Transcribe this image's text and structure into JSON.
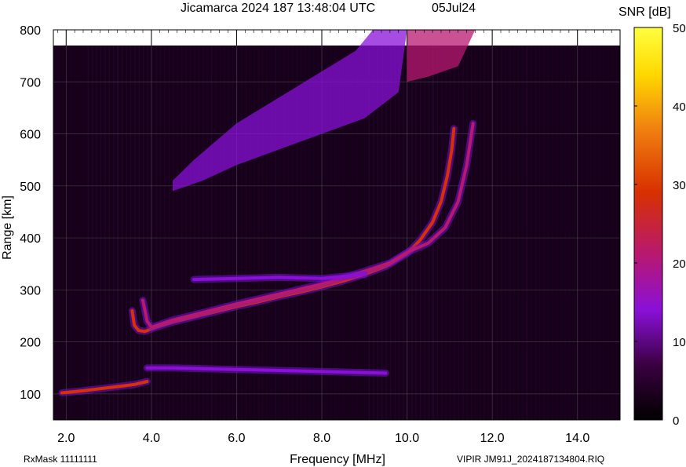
{
  "header": {
    "title": "Jicamarca 2024 187 13:48:04 UTC",
    "date": "05Jul24"
  },
  "footer": {
    "left": "RxMask 11111111",
    "right": "VIPIR  JM91J_2024187134804.RIQ"
  },
  "colorbar": {
    "label": "SNR [dB]",
    "ticks": [
      "50",
      "40",
      "30",
      "20",
      "10",
      "0"
    ],
    "range": [
      0,
      50
    ],
    "colors": [
      "#000000",
      "#3a0040",
      "#8a10d8",
      "#b81870",
      "#d83000",
      "#f08010",
      "#ffd800",
      "#ffff40"
    ]
  },
  "chart_data": {
    "type": "heatmap",
    "title": "Jicamarca 2024 187 13:48:04 UTC",
    "xlabel": "Frequency [MHz]",
    "ylabel": "Range [km]",
    "xlim": [
      1.7,
      15.0
    ],
    "ylim": [
      50,
      800
    ],
    "x_ticks": [
      "2.0",
      "4.0",
      "6.0",
      "8.0",
      "10.0",
      "12.0",
      "14.0"
    ],
    "y_ticks": [
      "100",
      "200",
      "300",
      "400",
      "500",
      "600",
      "700",
      "800"
    ],
    "grid": true,
    "background_color": "#16001a",
    "traces": [
      {
        "name": "",
        "snr": 28,
        "points": [
          [
            1.9,
            102
          ],
          [
            2.4,
            106
          ],
          [
            2.8,
            110
          ],
          [
            3.2,
            114
          ],
          [
            3.6,
            118
          ],
          [
            3.9,
            124
          ]
        ]
      },
      {
        "name": "",
        "snr": 24,
        "points": [
          [
            3.55,
            260
          ],
          [
            3.6,
            232
          ],
          [
            3.7,
            222
          ],
          [
            3.85,
            220
          ],
          [
            4.1,
            228
          ],
          [
            4.5,
            238
          ],
          [
            5.0,
            248
          ],
          [
            5.5,
            258
          ],
          [
            6.0,
            268
          ],
          [
            6.5,
            277
          ],
          [
            7.0,
            287
          ],
          [
            7.5,
            296
          ],
          [
            8.0,
            306
          ],
          [
            8.5,
            317
          ],
          [
            9.0,
            330
          ],
          [
            9.5,
            345
          ],
          [
            10.0,
            370
          ],
          [
            10.3,
            395
          ],
          [
            10.6,
            430
          ],
          [
            10.8,
            470
          ],
          [
            10.95,
            520
          ],
          [
            11.05,
            570
          ],
          [
            11.1,
            610
          ]
        ]
      },
      {
        "name": "",
        "snr": 20,
        "points": [
          [
            3.8,
            280
          ],
          [
            3.9,
            240
          ],
          [
            4.0,
            228
          ],
          [
            4.5,
            242
          ],
          [
            5.0,
            252
          ],
          [
            6.0,
            273
          ],
          [
            7.0,
            292
          ],
          [
            8.0,
            311
          ],
          [
            9.0,
            336
          ],
          [
            9.6,
            352
          ],
          [
            10.0,
            372
          ],
          [
            10.5,
            390
          ],
          [
            10.9,
            420
          ],
          [
            11.2,
            470
          ],
          [
            11.4,
            540
          ],
          [
            11.55,
            620
          ]
        ]
      },
      {
        "name": "",
        "snr": 14,
        "points": [
          [
            5.0,
            320
          ],
          [
            6.0,
            322
          ],
          [
            7.0,
            324
          ],
          [
            8.0,
            322
          ],
          [
            9.0,
            330
          ]
        ]
      },
      {
        "name": "",
        "snr": 10,
        "points": [
          [
            3.9,
            150
          ],
          [
            4.5,
            150
          ],
          [
            5.5,
            148
          ],
          [
            7.0,
            145
          ],
          [
            8.5,
            142
          ],
          [
            9.5,
            140
          ]
        ]
      }
    ],
    "regions": [
      {
        "name": "",
        "snr": 13,
        "polygon": [
          [
            4.5,
            490
          ],
          [
            5.2,
            510
          ],
          [
            6.0,
            540
          ],
          [
            7.0,
            570
          ],
          [
            8.0,
            600
          ],
          [
            9.0,
            630
          ],
          [
            9.8,
            680
          ],
          [
            10.0,
            800
          ],
          [
            9.2,
            800
          ],
          [
            8.8,
            760
          ],
          [
            8.0,
            720
          ],
          [
            7.0,
            670
          ],
          [
            6.0,
            620
          ],
          [
            5.0,
            550
          ],
          [
            4.5,
            510
          ]
        ]
      },
      {
        "name": "",
        "snr": 15,
        "polygon": [
          [
            10.0,
            700
          ],
          [
            10.5,
            710
          ],
          [
            11.2,
            730
          ],
          [
            11.6,
            800
          ],
          [
            10.0,
            800
          ]
        ]
      }
    ]
  }
}
